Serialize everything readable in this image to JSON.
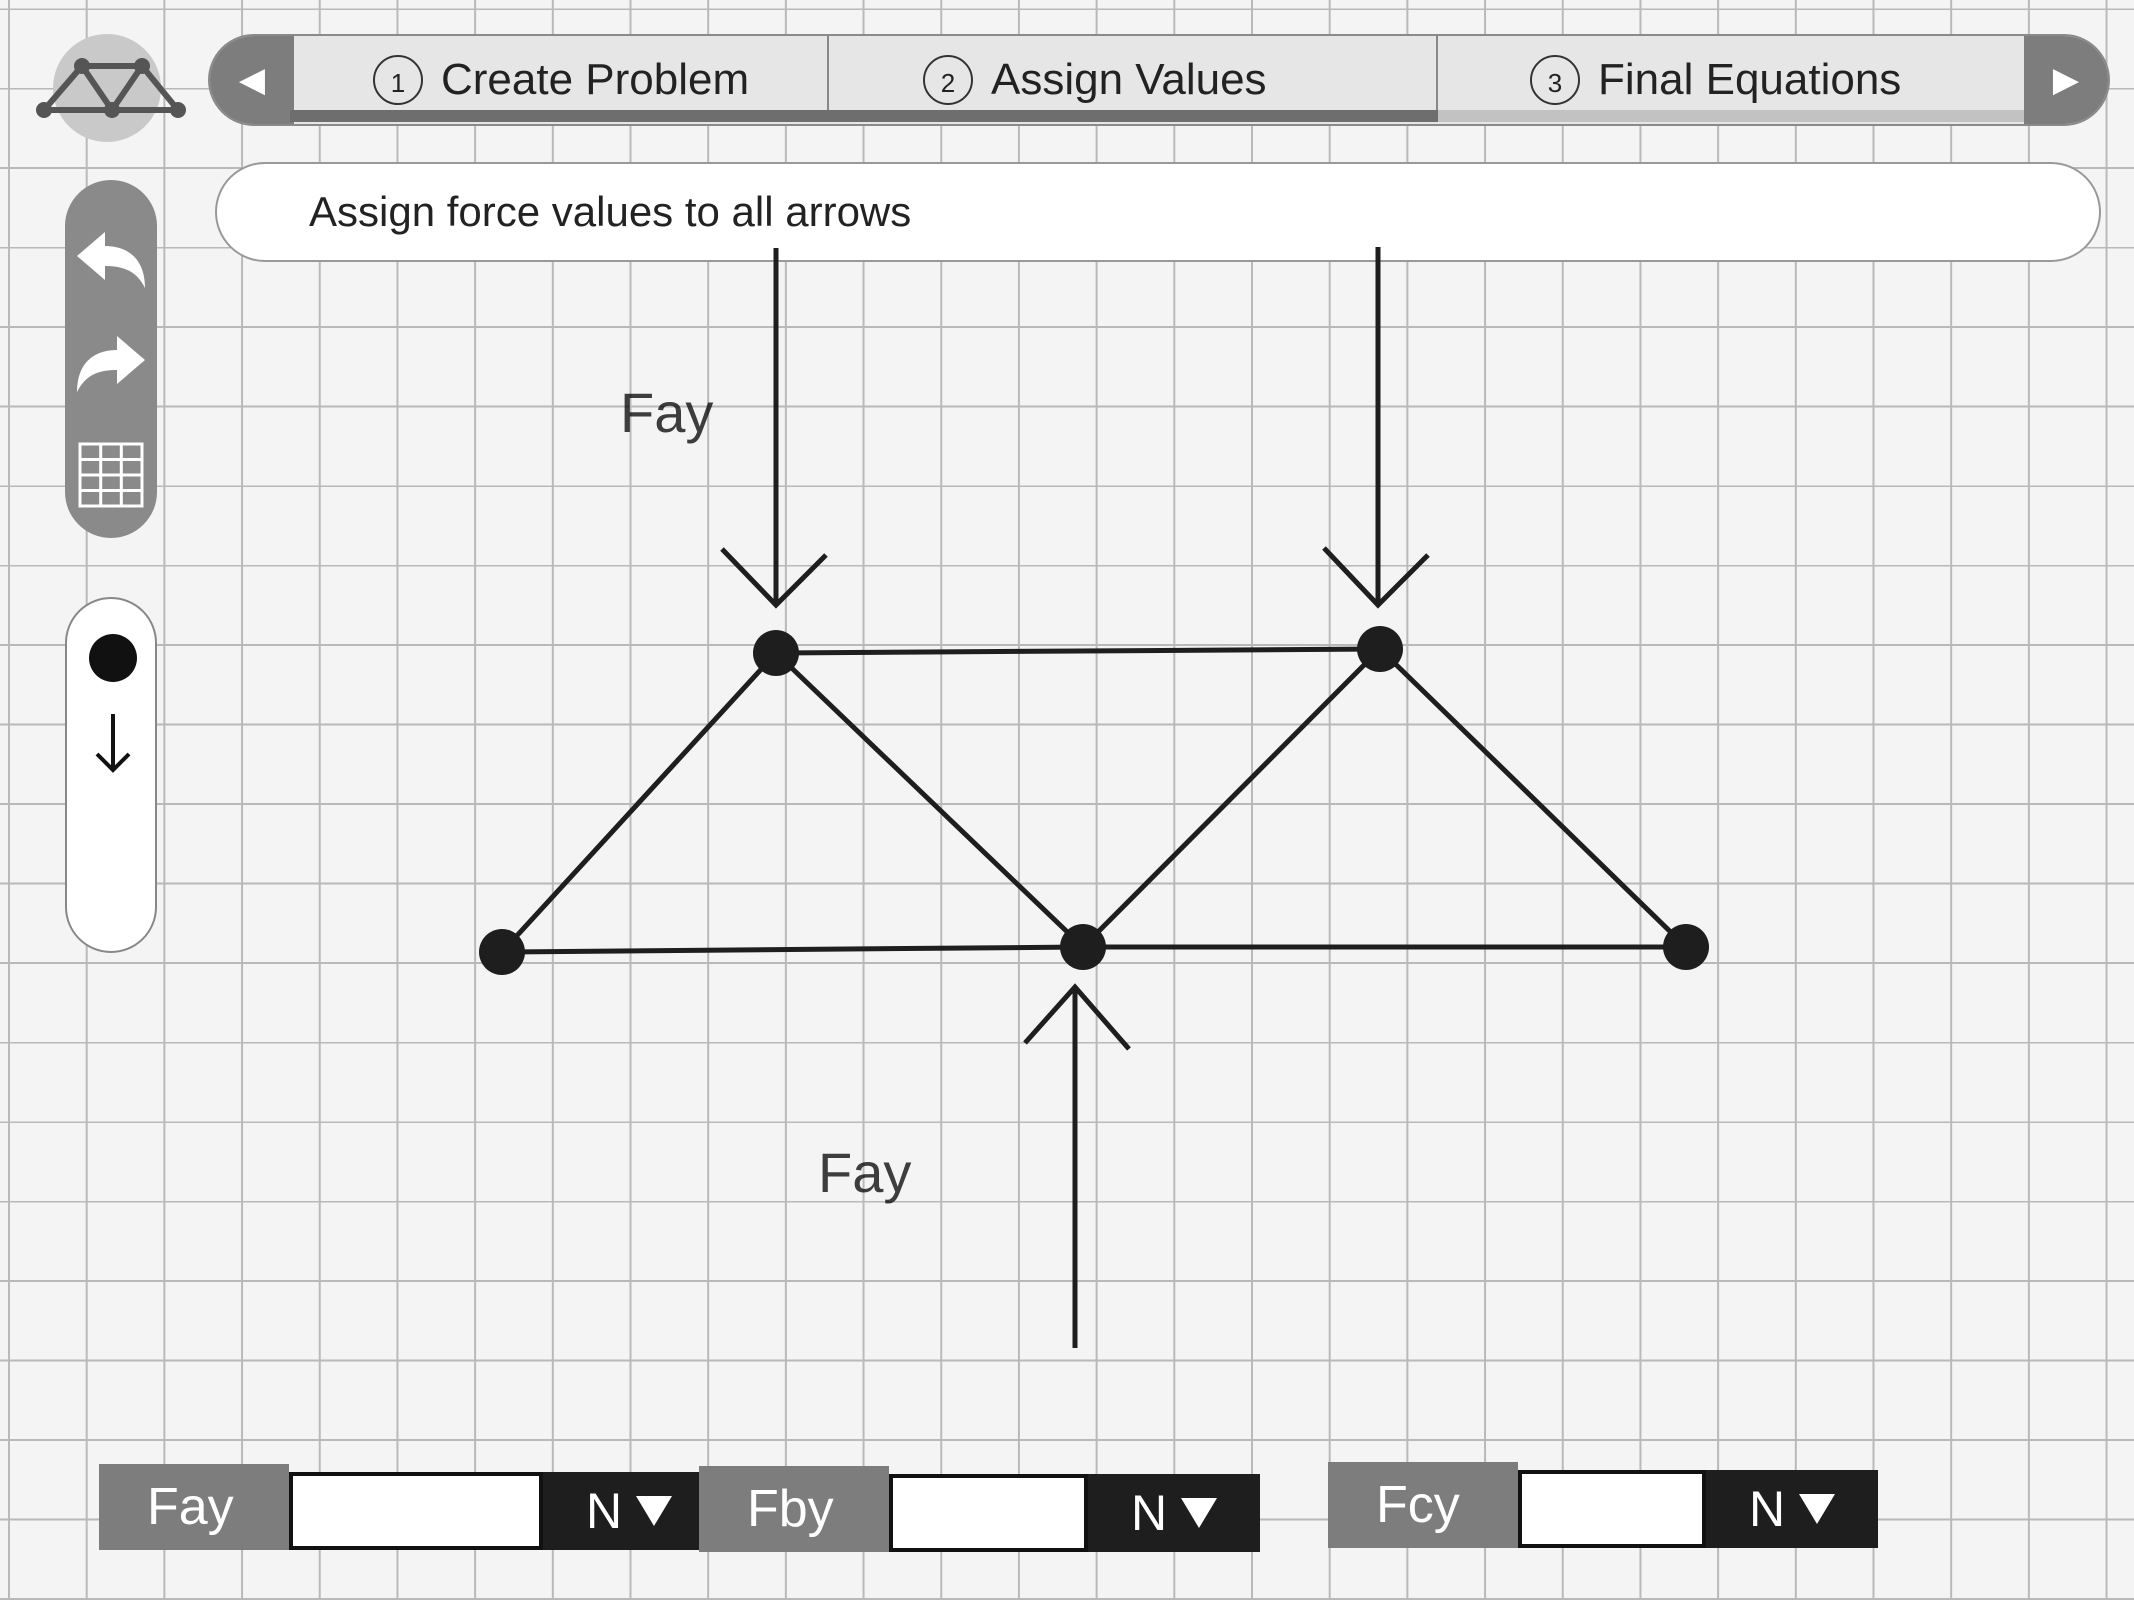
{
  "steps": [
    {
      "number": "1",
      "label": "Create Problem"
    },
    {
      "number": "2",
      "label": "Assign Values"
    },
    {
      "number": "3",
      "label": "Final Equations"
    }
  ],
  "step_progress": 0.66,
  "instruction": "Assign force values to all arrows",
  "toolbar": {
    "edit_icons": [
      "undo-icon",
      "redo-icon",
      "grid-icon"
    ],
    "draw_icons": [
      "node-tool-icon",
      "force-arrow-tool-icon"
    ]
  },
  "canvas": {
    "ghost_labels": [
      "Fay",
      "Fay"
    ]
  },
  "forces": [
    {
      "label": "Fay",
      "value": "",
      "unit": "N"
    },
    {
      "label": "Fby",
      "value": "",
      "unit": "N"
    },
    {
      "label": "Fcy",
      "value": "",
      "unit": "N"
    }
  ],
  "colors": {
    "panel_gray": "#7d7d7d",
    "ink": "#1e1e1e",
    "grid_line": "#b9b9b9"
  }
}
